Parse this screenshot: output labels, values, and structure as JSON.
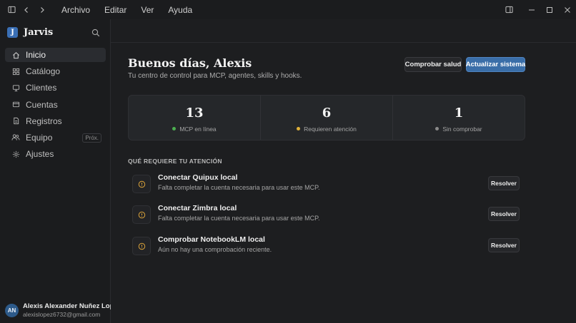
{
  "menu": [
    "Archivo",
    "Editar",
    "Ver",
    "Ayuda"
  ],
  "brand": {
    "logo_letter": "J",
    "name": "Jarvis"
  },
  "nav": [
    {
      "label": "Inicio",
      "icon": "home-icon",
      "active": true
    },
    {
      "label": "Catálogo",
      "icon": "grid-icon"
    },
    {
      "label": "Clientes",
      "icon": "monitor-icon"
    },
    {
      "label": "Cuentas",
      "icon": "card-icon"
    },
    {
      "label": "Registros",
      "icon": "document-icon"
    },
    {
      "label": "Equipo",
      "icon": "users-icon",
      "badge": "Próx."
    },
    {
      "label": "Ajustes",
      "icon": "gear-icon"
    }
  ],
  "user": {
    "initials": "AN",
    "name": "Alexis Alexander Nuñez Lopez",
    "email": "alexislopez6732@gmail.com"
  },
  "main": {
    "greeting": "Buenos días, Alexis",
    "subtitle": "Tu centro de control para MCP, agentes, skills y hooks.",
    "buttons": {
      "health": "Comprobar salud",
      "update": "Actualizar sistema"
    },
    "stats": [
      {
        "value": "13",
        "label": "MCP en línea",
        "dot_color": "#4caf50"
      },
      {
        "value": "6",
        "label": "Requieren atención",
        "dot_color": "#e0b13a"
      },
      {
        "value": "1",
        "label": "Sin comprobar",
        "dot_color": "#8a8a8a"
      }
    ],
    "section_title": "QUÉ REQUIERE TU ATENCIÓN",
    "tasks": [
      {
        "title": "Conectar Quipux local",
        "desc": "Falta completar la cuenta necesaria para usar este MCP.",
        "action": "Resolver"
      },
      {
        "title": "Conectar Zimbra local",
        "desc": "Falta completar la cuenta necesaria para usar este MCP.",
        "action": "Resolver"
      },
      {
        "title": "Comprobar NotebookLM local",
        "desc": "Aún no hay una comprobación reciente.",
        "action": "Resolver"
      }
    ]
  },
  "colors": {
    "accent": "#3a6ea8",
    "warning_icon": "#d9a23a"
  }
}
